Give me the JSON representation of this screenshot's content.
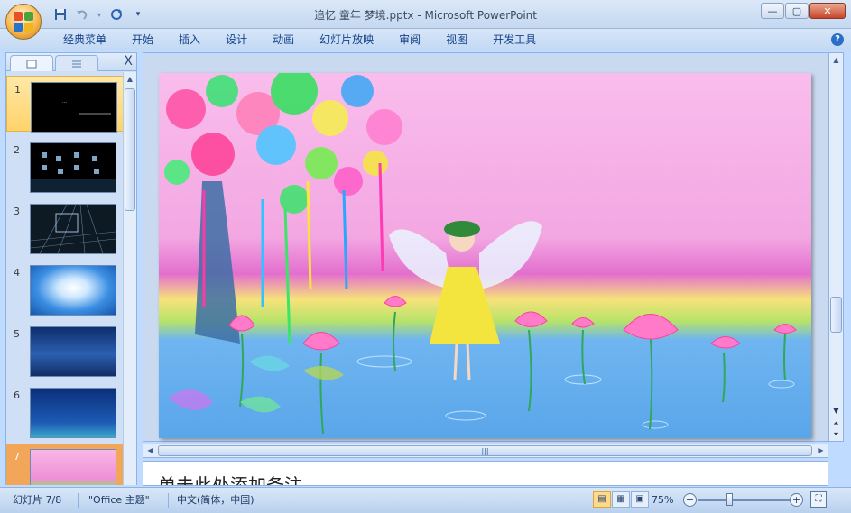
{
  "window": {
    "title": "追忆 童年 梦境.pptx - Microsoft PowerPoint",
    "controls": {
      "minimize": "—",
      "maximize": "▢",
      "close": "✕"
    }
  },
  "qat": {
    "save_icon": "save-icon",
    "undo_icon": "undo-icon",
    "redo_icon": "redo-icon",
    "menu_icon": "customize-icon"
  },
  "ribbon": {
    "tabs": [
      "经典菜单",
      "开始",
      "插入",
      "设计",
      "动画",
      "幻灯片放映",
      "审阅",
      "视图",
      "开发工具"
    ],
    "help": "?"
  },
  "panel": {
    "close": "X",
    "thumbnails": [
      {
        "num": "1",
        "bg": "#000000"
      },
      {
        "num": "2",
        "bg": "#000000"
      },
      {
        "num": "3",
        "bg": "#0d1a24"
      },
      {
        "num": "4",
        "bg": "#1b6fd0"
      },
      {
        "num": "5",
        "bg": "#14337a"
      },
      {
        "num": "6",
        "bg": "#0f3d8a"
      },
      {
        "num": "7",
        "bg": "#f7a8d8"
      }
    ],
    "selected": "1"
  },
  "slide": {
    "sky_top": "#f7b6e9",
    "sky_mid": "#e98ad8",
    "water": "#6fb5f0"
  },
  "notes": {
    "placeholder": "单击此处添加备注"
  },
  "status": {
    "slide_info": "幻灯片 7/8",
    "theme": "\"Office 主题\"",
    "language": "中文(简体，中国)",
    "zoom": "75%",
    "zoom_out": "−",
    "zoom_in": "+"
  }
}
